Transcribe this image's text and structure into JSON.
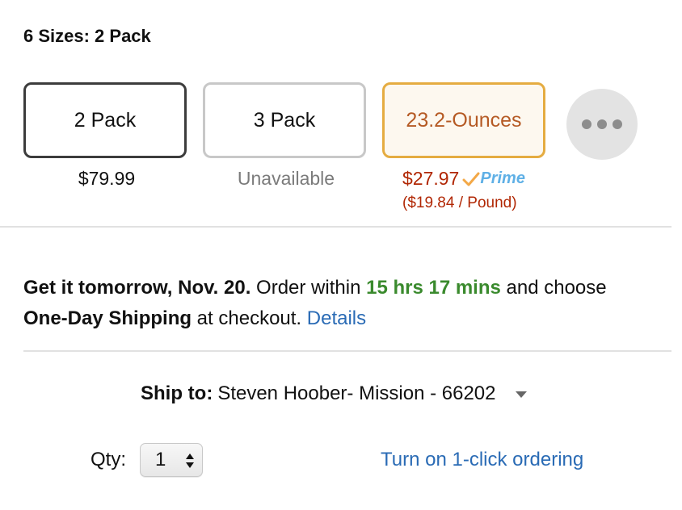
{
  "sizes": {
    "title": "6 Sizes: 2 Pack",
    "options": [
      {
        "label": "2 Pack",
        "price": "$79.99",
        "state": "selected"
      },
      {
        "label": "3 Pack",
        "price": "Unavailable",
        "state": "unavailable"
      },
      {
        "label": "23.2-Ounces",
        "price": "$27.97",
        "per_unit": "($19.84 / Pound)",
        "badge": "Prime",
        "state": "hovered"
      }
    ],
    "more_icon": "ellipsis-icon"
  },
  "delivery": {
    "part1": "Get it tomorrow, Nov. 20.",
    "part2": " Order within ",
    "countdown": "15 hrs 17 mins",
    "part3": " and choose ",
    "part4": "One-Day Shipping",
    "part5": " at checkout. ",
    "details_link": "Details"
  },
  "ship_to": {
    "label": "Ship to:",
    "address": "Steven Hoober- Mission - 66202"
  },
  "qty": {
    "label": "Qty:",
    "value": "1"
  },
  "one_click_link": "Turn on 1-click ordering",
  "colors": {
    "price_red": "#b12704",
    "countdown_green": "#3a8a2d",
    "link_blue": "#2a6bb5",
    "hover_border": "#e5ac41",
    "prime_blue": "#5fb0e6"
  }
}
